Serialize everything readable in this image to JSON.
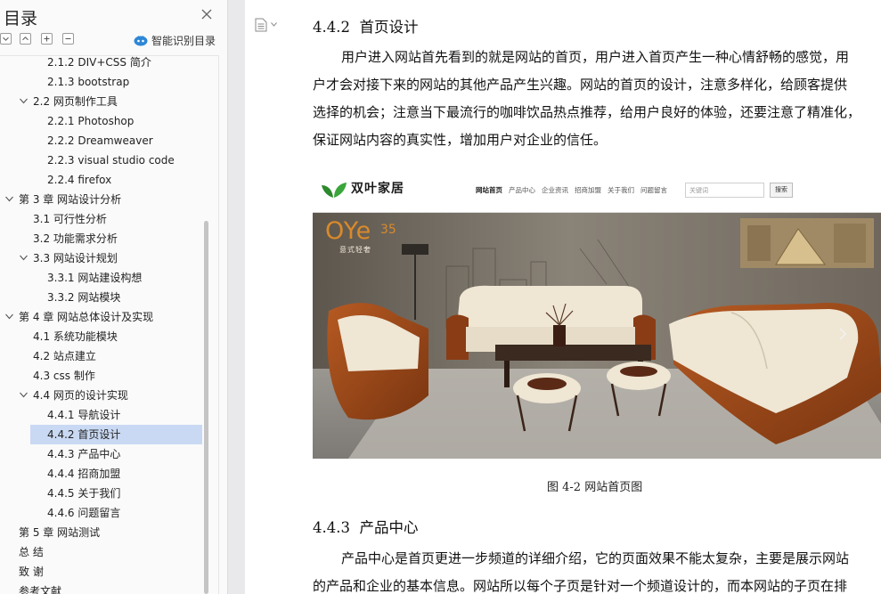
{
  "toc": {
    "title": "目录",
    "smart_toc_label": "智能识别目录",
    "items": [
      {
        "label": "2.1.2 DIV+CSS 简介",
        "level": 3,
        "expanded": null,
        "selected": false
      },
      {
        "label": "2.1.3 bootstrap",
        "level": 3,
        "expanded": null,
        "selected": false
      },
      {
        "label": "2.2  网页制作工具",
        "level": 2,
        "expanded": true,
        "selected": false
      },
      {
        "label": "2.2.1 Photoshop",
        "level": 3,
        "expanded": null,
        "selected": false
      },
      {
        "label": "2.2.2 Dreamweaver",
        "level": 3,
        "expanded": null,
        "selected": false
      },
      {
        "label": "2.2.3 visual studio code",
        "level": 3,
        "expanded": null,
        "selected": false
      },
      {
        "label": "2.2.4 firefox",
        "level": 3,
        "expanded": null,
        "selected": false
      },
      {
        "label": "第 3 章  网站设计分析",
        "level": 1,
        "expanded": true,
        "selected": false
      },
      {
        "label": "3.1  可行性分析",
        "level": 2,
        "expanded": null,
        "selected": false
      },
      {
        "label": "3.2  功能需求分析",
        "level": 2,
        "expanded": null,
        "selected": false
      },
      {
        "label": "3.3  网站设计规划",
        "level": 2,
        "expanded": true,
        "selected": false
      },
      {
        "label": "3.3.1  网站建设构想",
        "level": 3,
        "expanded": null,
        "selected": false
      },
      {
        "label": "3.3.2  网站模块",
        "level": 3,
        "expanded": null,
        "selected": false
      },
      {
        "label": "第 4 章  网站总体设计及实现",
        "level": 1,
        "expanded": true,
        "selected": false
      },
      {
        "label": "4.1  系统功能模块",
        "level": 2,
        "expanded": null,
        "selected": false
      },
      {
        "label": "4.2  站点建立",
        "level": 2,
        "expanded": null,
        "selected": false
      },
      {
        "label": "4.3 css 制作",
        "level": 2,
        "expanded": null,
        "selected": false
      },
      {
        "label": "4.4  网页的设计实现",
        "level": 2,
        "expanded": true,
        "selected": false
      },
      {
        "label": "4.4.1  导航设计",
        "level": 3,
        "expanded": null,
        "selected": false
      },
      {
        "label": "4.4.2  首页设计",
        "level": 3,
        "expanded": null,
        "selected": true
      },
      {
        "label": "4.4.3  产品中心",
        "level": 3,
        "expanded": null,
        "selected": false
      },
      {
        "label": "4.4.4  招商加盟",
        "level": 3,
        "expanded": null,
        "selected": false
      },
      {
        "label": "4.4.5  关于我们",
        "level": 3,
        "expanded": null,
        "selected": false
      },
      {
        "label": "4.4.6  问题留言",
        "level": 3,
        "expanded": null,
        "selected": false
      },
      {
        "label": "第 5 章  网站测试",
        "level": 1,
        "expanded": null,
        "selected": false
      },
      {
        "label": "总   结",
        "level": 1,
        "expanded": null,
        "selected": false
      },
      {
        "label": "致   谢",
        "level": 1,
        "expanded": null,
        "selected": false
      },
      {
        "label": "参考文献",
        "level": 1,
        "expanded": null,
        "selected": false
      }
    ]
  },
  "doc": {
    "section1": {
      "heading_num": "4.4.2",
      "heading_title": "首页设计",
      "lines": [
        "用户进入网站首先看到的就是网站的首页，用户进入首页产生一种心情舒畅的感觉，用",
        "户才会对接下来的网站的其他产品产生兴趣。网站的首页的设计，注意多样化，给顾客提供",
        "选择的机会；注意当下最流行的咖啡饮品热点推荐，给用户良好的体验，还要注意了精准化，",
        "保证网站内容的真实性，增加用户对企业的信任。"
      ]
    },
    "figure": {
      "caption": "图 4-2  网站首页图",
      "site_logo": "双叶家居",
      "site_nav": [
        "网站首页",
        "产品中心",
        "企业资讯",
        "招商加盟",
        "关于我们",
        "问题留言"
      ],
      "search_placeholder": "关键词",
      "search_button": "搜索",
      "banner_brand": "OYe",
      "banner_brand_num": "35",
      "banner_sub": "意式轻奢"
    },
    "section2": {
      "heading_num": "4.4.3",
      "heading_title": "产品中心",
      "lines": [
        "产品中心是首页更进一步频道的详细介绍，它的页面效果不能太复杂，主要是展示网站",
        "的产品和企业的基本信息。网站所以每个子页是针对一个频道设计的，而本网站的子页在排"
      ]
    }
  },
  "colors": {
    "selected_bg": "#c9d9f3",
    "smart_toc_icon": "#2f86d6",
    "logo_green": "#2c8a2c"
  },
  "icons": {
    "close": "close-icon",
    "collapse_all": "collapse-all-icon",
    "expand_all": "expand-all-icon",
    "add": "add-icon",
    "remove": "remove-icon",
    "smart_toc": "smart-toc-icon",
    "document": "document-icon"
  }
}
